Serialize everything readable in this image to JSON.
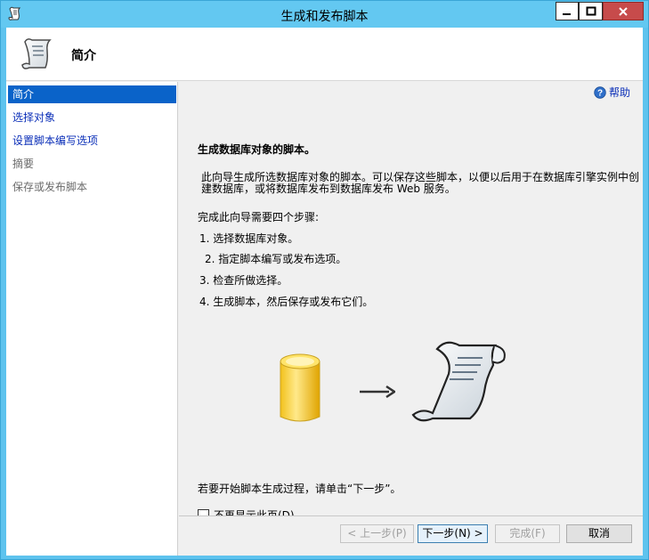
{
  "window": {
    "title": "生成和发布脚本"
  },
  "header": {
    "title": "简介"
  },
  "nav": {
    "items": [
      {
        "label": "简介",
        "state": "selected"
      },
      {
        "label": "选择对象",
        "state": "link"
      },
      {
        "label": "设置脚本编写选项",
        "state": "link"
      },
      {
        "label": "摘要",
        "state": "disabled"
      },
      {
        "label": "保存或发布脚本",
        "state": "disabled"
      }
    ]
  },
  "main": {
    "help_label": "帮助",
    "heading": "生成数据库对象的脚本。",
    "description": "此向导生成所选数据库对象的脚本。可以保存这些脚本，以便以后用于在数据库引擎实例中创建数据库，或将数据库发布到数据库发布 Web 服务。",
    "steps_intro": "完成此向导需要四个步骤:",
    "steps": [
      "1.  选择数据库对象。",
      "2.  指定脚本编写或发布选项。",
      "3.  检查所做选择。",
      "4.  生成脚本，然后保存或发布它们。"
    ],
    "start_text": "若要开始脚本生成过程，请单击“下一步”。",
    "dont_show_label": "不再显示此页(D)。",
    "dont_show_checked": false
  },
  "footer": {
    "prev_label": "< 上一步(P)",
    "next_label": "下一步(N) >",
    "finish_label": "完成(F)",
    "cancel_label": "取消"
  },
  "colors": {
    "titlebar": "#63c8f1",
    "nav_selected": "#0a63c9",
    "link": "#0b2fb8",
    "close_button": "#c74b4b"
  },
  "icons": {
    "app": "script-scroll-icon",
    "header": "script-scroll-icon",
    "help": "help-question-icon"
  }
}
